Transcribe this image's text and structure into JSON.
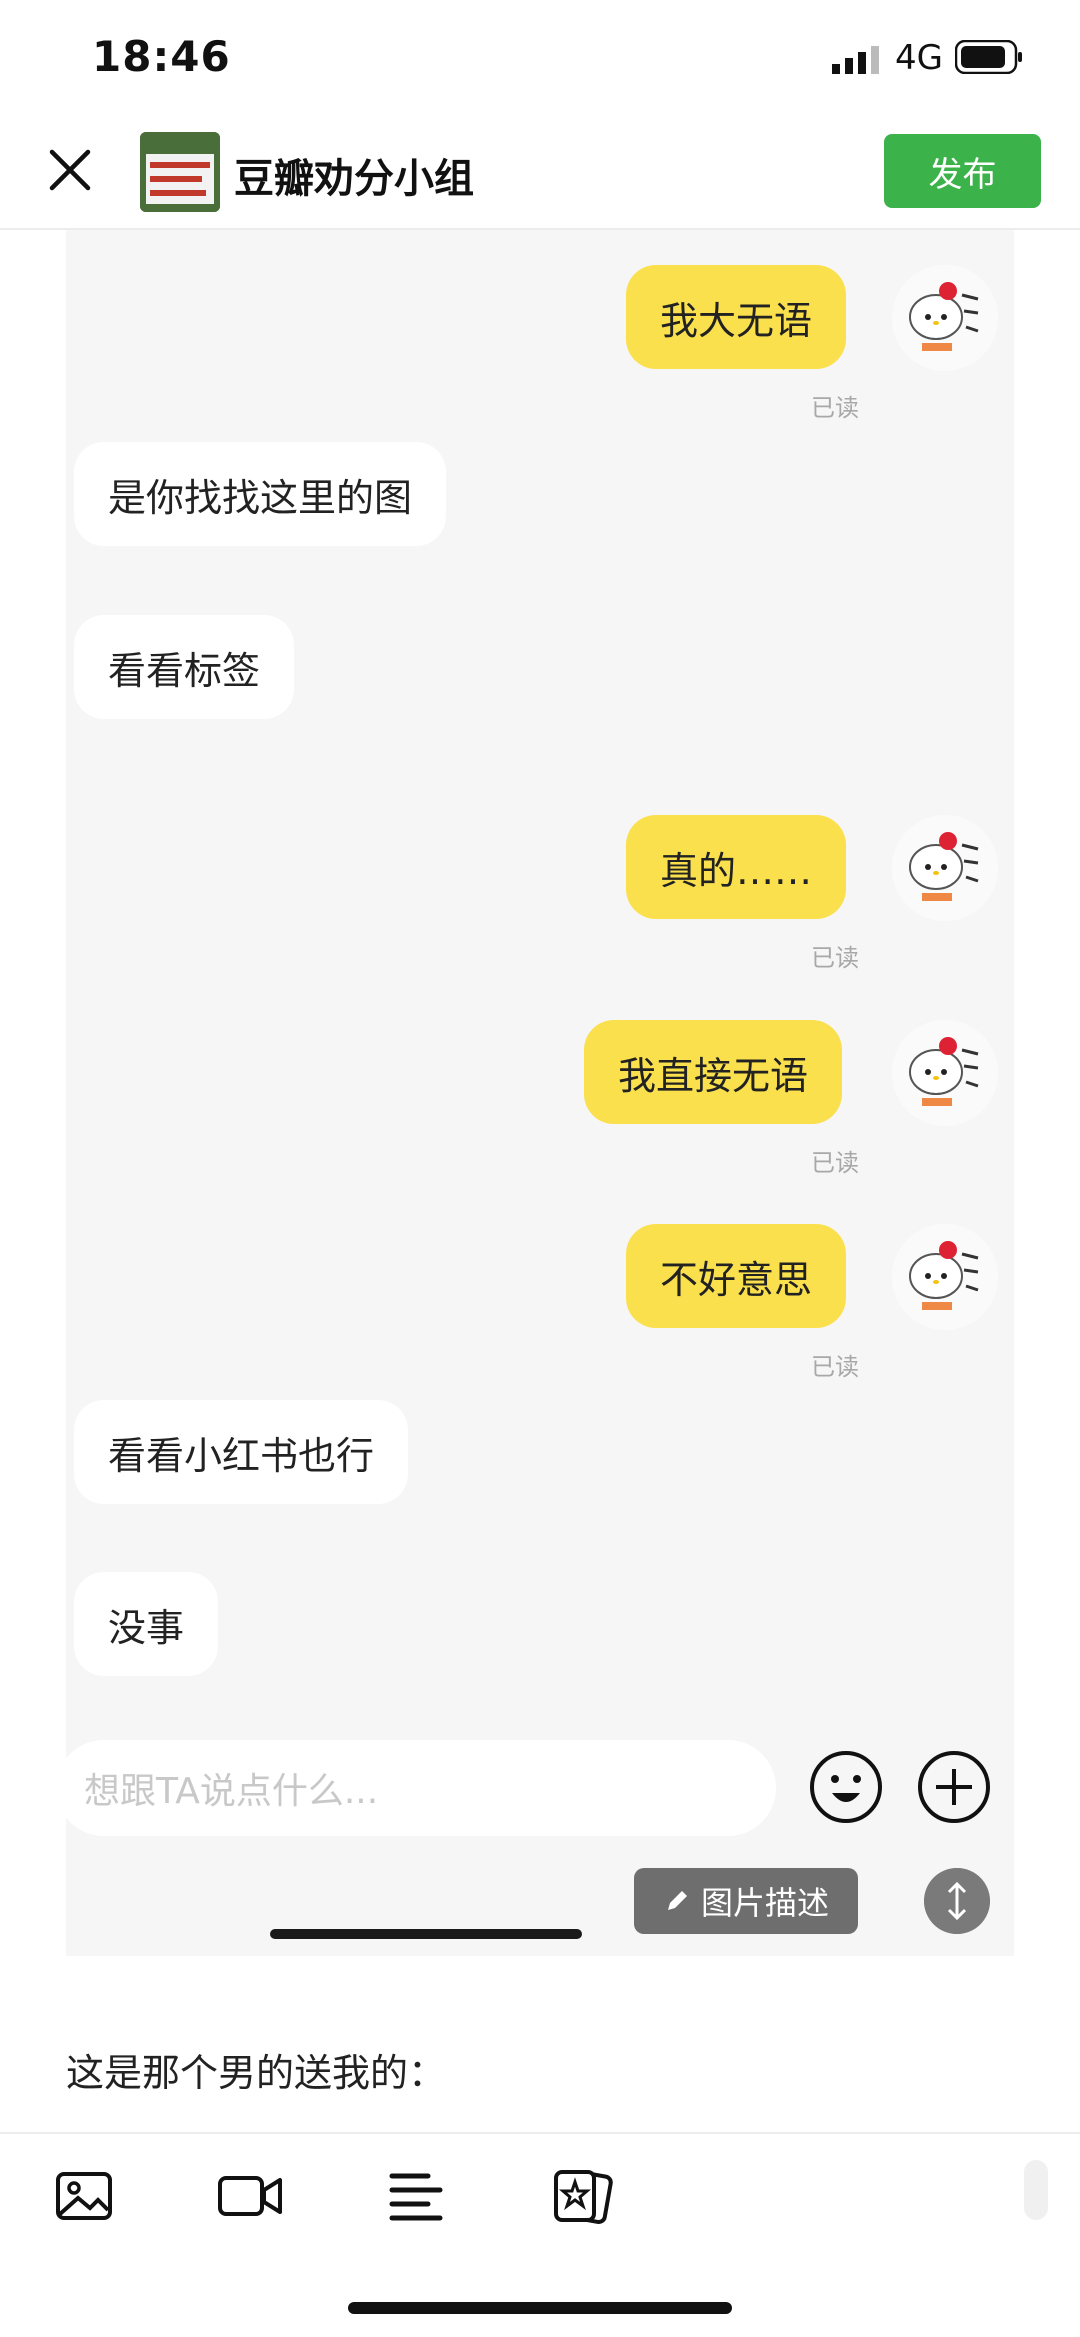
{
  "status_bar": {
    "time": "18:46",
    "network": "4G"
  },
  "header": {
    "title": "豆瓣劝分小组",
    "publish_label": "发布"
  },
  "chat": {
    "messages": [
      {
        "side": "out",
        "text": "我大无语",
        "status": "已读"
      },
      {
        "side": "in",
        "text": "是你找找这里的图"
      },
      {
        "side": "in",
        "text": "看看标签"
      },
      {
        "side": "out",
        "text": "真的……",
        "status": "已读"
      },
      {
        "side": "out",
        "text": "我直接无语",
        "status": "已读"
      },
      {
        "side": "out",
        "text": "不好意思",
        "status": "已读"
      },
      {
        "side": "in",
        "text": "看看小红书也行"
      },
      {
        "side": "in",
        "text": "没事"
      }
    ],
    "input_placeholder": "想跟TA说点什么...",
    "emoji_icon": "emoji-icon",
    "plus_icon": "plus-circle-icon"
  },
  "image_overlay": {
    "desc_label": "图片描述"
  },
  "caption": "这是那个男的送我的：",
  "toolbar": {
    "items": [
      "image-icon",
      "video-icon",
      "text-format-icon",
      "sticker-icon"
    ]
  },
  "colors": {
    "publish_green": "#3cb24a",
    "outgoing_bubble": "#fae04d",
    "chat_bg": "#f6f6f6"
  }
}
